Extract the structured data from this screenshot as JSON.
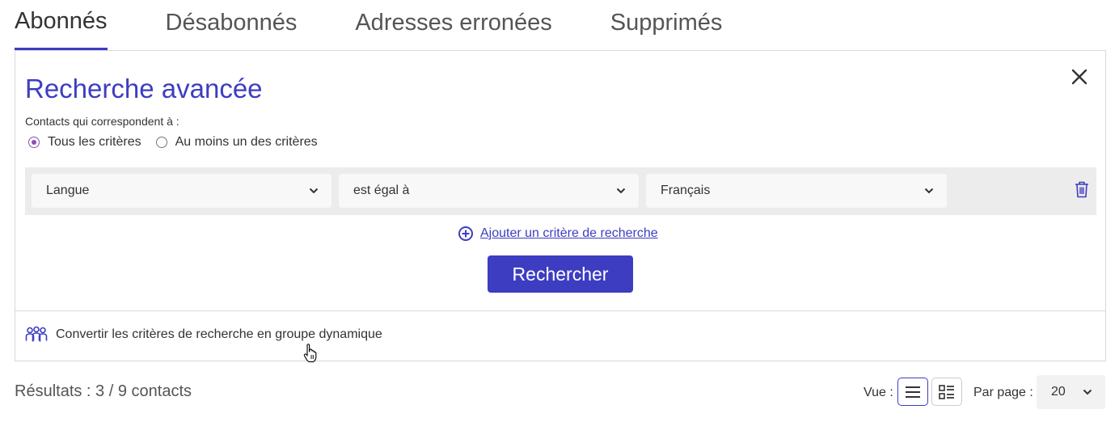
{
  "tabs": [
    "Abonnés",
    "Désabonnés",
    "Adresses erronées",
    "Supprimés"
  ],
  "active_tab": "Abonnés",
  "search_panel": {
    "title": "Recherche avancée",
    "match_label": "Contacts qui correspondent à :",
    "radio_all": "Tous les critères",
    "radio_any": "Au moins un des critères",
    "selected_radio": "Tous les critères",
    "criterion": {
      "field": "Langue",
      "operator": "est égal à",
      "value": "Français"
    },
    "add_criterion": "Ajouter un critère de recherche",
    "search_button": "Rechercher",
    "convert_label": "Convertir les critères de recherche en groupe dynamique"
  },
  "results": {
    "text": "Résultats : 3 / 9 contacts",
    "view_label": "Vue :",
    "view_mode": "list",
    "per_page_label": "Par page :",
    "per_page_value": "20"
  },
  "icons": [
    "close-icon",
    "chevron-down-icon",
    "trash-icon",
    "plus-circle-icon",
    "group-icon",
    "list-view-icon",
    "grid-view-icon",
    "pointer-cursor-icon"
  ],
  "colors": {
    "accent": "#3d3dc2",
    "radio_selected": "#8a4fb5",
    "criteria_row_bg": "#ececec"
  }
}
